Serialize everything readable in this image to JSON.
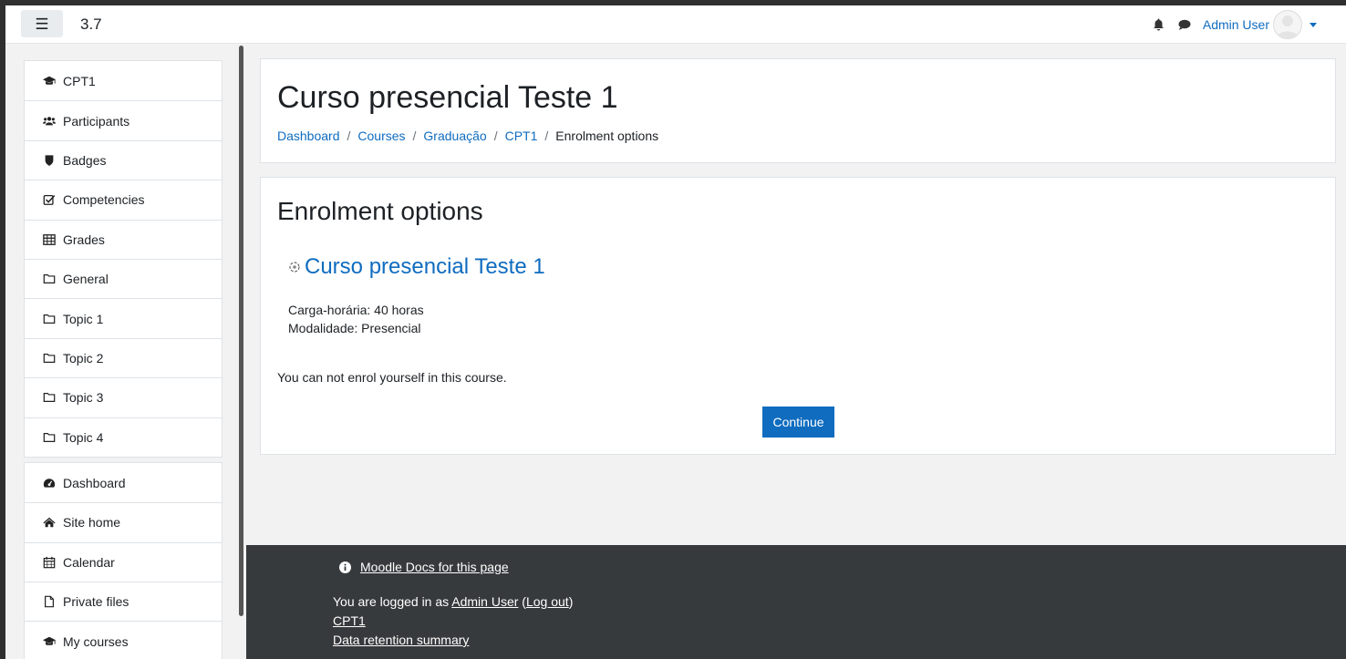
{
  "navbar": {
    "site_name": "3.7",
    "user_name": "Admin User"
  },
  "drawer": {
    "course_items": [
      {
        "label": "CPT1",
        "icon": "graduation-cap-icon"
      },
      {
        "label": "Participants",
        "icon": "users-icon"
      },
      {
        "label": "Badges",
        "icon": "shield-icon"
      },
      {
        "label": "Competencies",
        "icon": "check-square-icon"
      },
      {
        "label": "Grades",
        "icon": "table-icon"
      },
      {
        "label": "General",
        "icon": "folder-icon"
      },
      {
        "label": "Topic 1",
        "icon": "folder-icon"
      },
      {
        "label": "Topic 2",
        "icon": "folder-icon"
      },
      {
        "label": "Topic 3",
        "icon": "folder-icon"
      },
      {
        "label": "Topic 4",
        "icon": "folder-icon"
      }
    ],
    "site_items": [
      {
        "label": "Dashboard",
        "icon": "dashboard-icon"
      },
      {
        "label": "Site home",
        "icon": "home-icon"
      },
      {
        "label": "Calendar",
        "icon": "calendar-icon"
      },
      {
        "label": "Private files",
        "icon": "file-icon"
      },
      {
        "label": "My courses",
        "icon": "graduation-cap-icon"
      }
    ]
  },
  "header": {
    "title": "Curso presencial Teste 1",
    "breadcrumb": [
      "Dashboard",
      "Courses",
      "Graduação",
      "CPT1",
      "Enrolment options"
    ],
    "separator": "/"
  },
  "content": {
    "heading": "Enrolment options",
    "course_name": "Curso presencial Teste 1",
    "summary_line1": "Carga-horária: 40 horas",
    "summary_line2": "Modalidade: Presencial",
    "notice": "You can not enrol yourself in this course.",
    "continue_label": "Continue"
  },
  "footer": {
    "docs_link": "Moodle Docs for this page",
    "logged_in_prefix": "You are logged in as ",
    "user_link": "Admin User",
    "logout_link": "Log out",
    "course_link": "CPT1",
    "retention_link": "Data retention summary"
  },
  "colors": {
    "link": "#0f6cbf",
    "footer_bg": "#373a3c",
    "button_bg": "#0f6cbf"
  }
}
